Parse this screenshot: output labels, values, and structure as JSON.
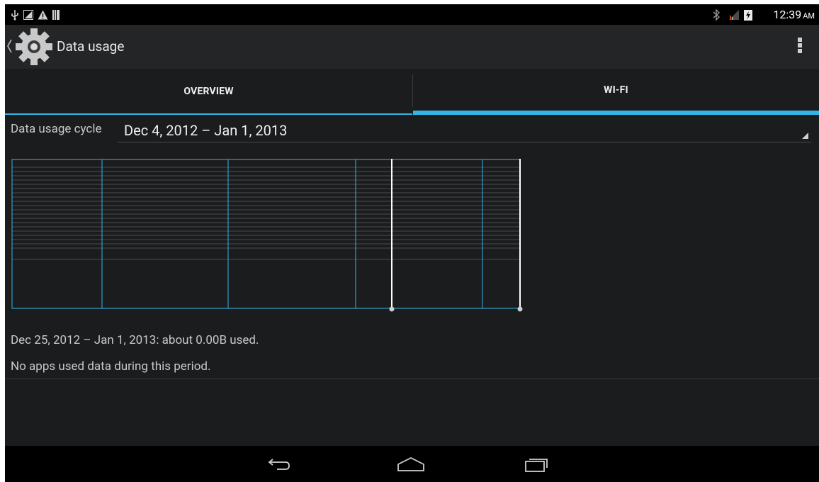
{
  "status_bar": {
    "time": "12:39",
    "ampm": "AM",
    "left_icons": [
      "usb-icon",
      "notification-icon",
      "warning-icon",
      "storage-icon"
    ],
    "right_icons": [
      "bluetooth-icon",
      "signal-icon",
      "battery-icon"
    ]
  },
  "action_bar": {
    "title": "Data usage",
    "app_icon": "gear-icon",
    "up_icon": "chevron-left-icon",
    "overflow_icon": "overflow-menu-icon"
  },
  "tabs": [
    {
      "label": "OVERVIEW",
      "selected": false
    },
    {
      "label": "WI-FI",
      "selected": true
    }
  ],
  "cycle": {
    "label": "Data usage cycle",
    "value": "Dec 4, 2012 – Jan 1, 2013"
  },
  "chart_data": {
    "type": "area",
    "title": "",
    "xlabel": "",
    "ylabel": "",
    "series": [],
    "selection_start": "Dec 25, 2012",
    "selection_end": "Jan 1, 2013",
    "grid": true
  },
  "usage_summary": "Dec 25, 2012 – Jan 1, 2013: about 0.00B used.",
  "no_apps_message": "No apps used data during this period.",
  "colors": {
    "accent": "#33b5e5",
    "background": "#1b1c1e",
    "action_bar": "#232527"
  },
  "nav": {
    "back_icon": "back-icon",
    "home_icon": "home-icon",
    "recents_icon": "recent-apps-icon"
  }
}
